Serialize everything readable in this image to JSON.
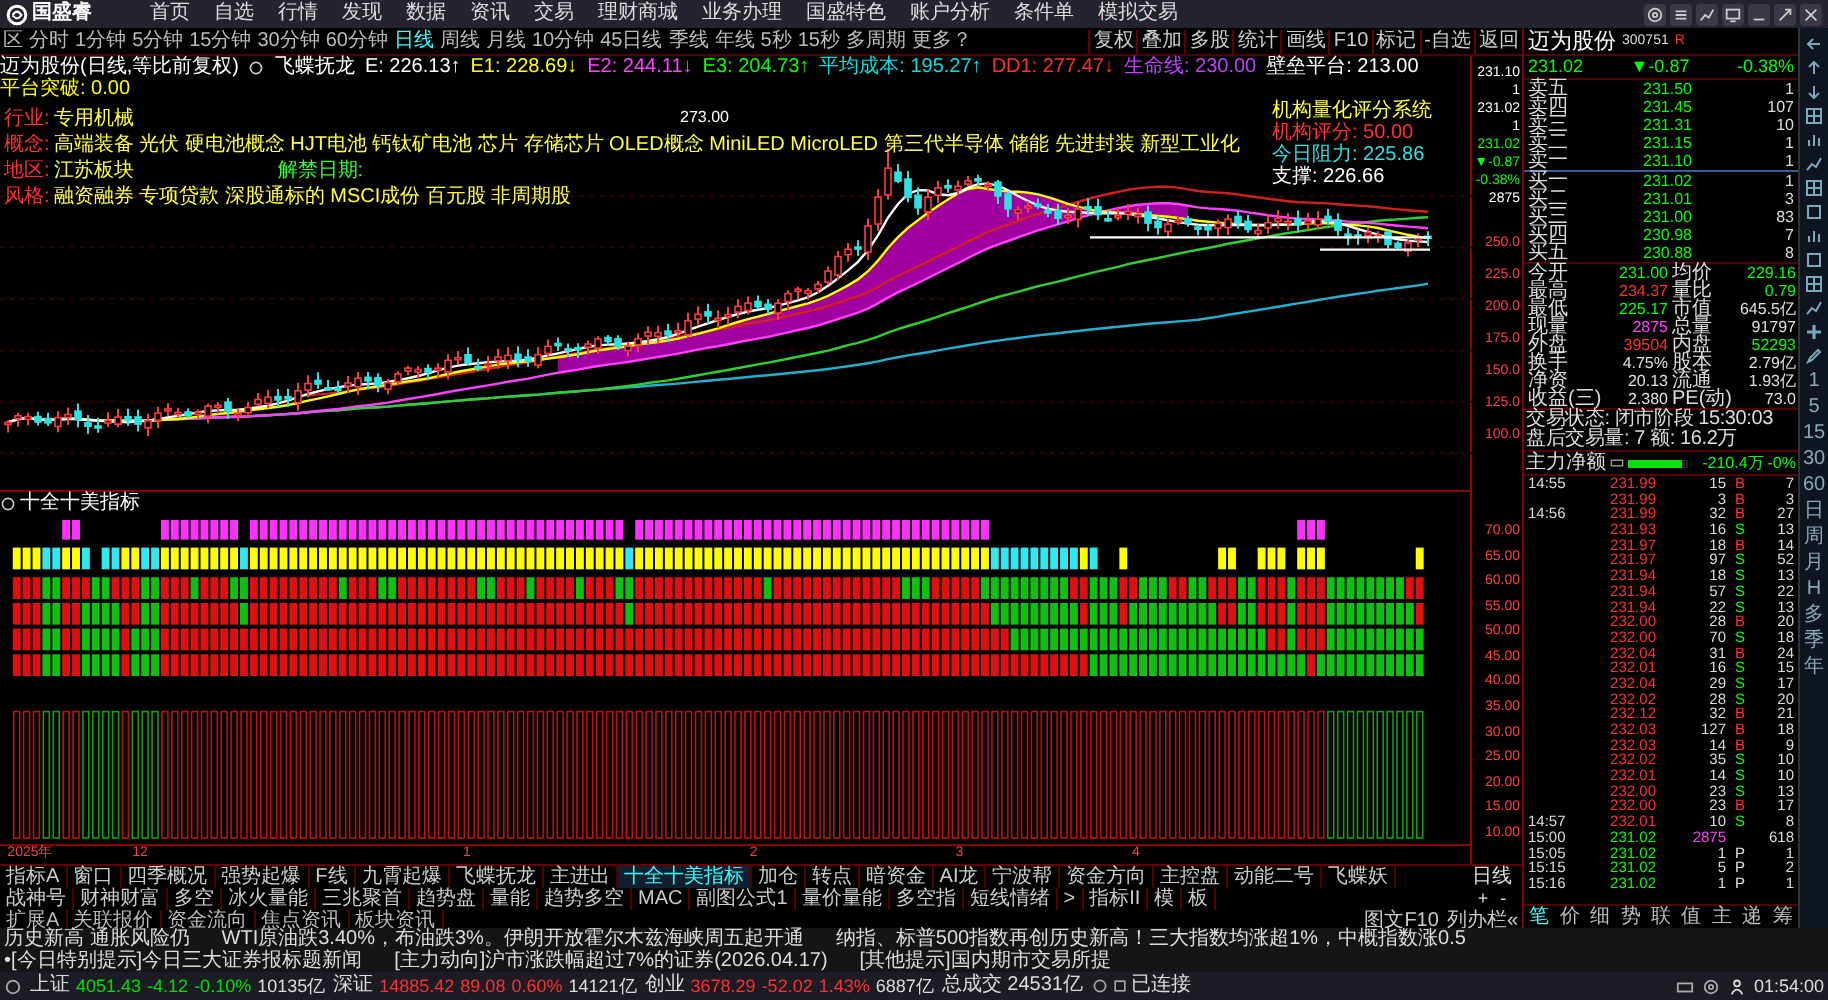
{
  "menu_bar": {
    "logo": "国盛睿",
    "items": [
      "首页",
      "自选",
      "行情",
      "发现",
      "数据",
      "资讯",
      "交易",
      "理财商城",
      "业务办理",
      "国盛特色",
      "账户分析",
      "条件单",
      "模拟交易"
    ]
  },
  "period_bar": {
    "items": [
      {
        "label": "区",
        "selected": false
      },
      {
        "label": "分时",
        "selected": false
      },
      {
        "label": "1分钟",
        "selected": false
      },
      {
        "label": "5分钟",
        "selected": false
      },
      {
        "label": "15分钟",
        "selected": false
      },
      {
        "label": "30分钟",
        "selected": false
      },
      {
        "label": "60分钟",
        "selected": false
      },
      {
        "label": "日线",
        "selected": true
      },
      {
        "label": "周线",
        "selected": false
      },
      {
        "label": "月线",
        "selected": false
      },
      {
        "label": "10分钟",
        "selected": false
      },
      {
        "label": "45日线",
        "selected": false
      },
      {
        "label": "季线",
        "selected": false
      },
      {
        "label": "年线",
        "selected": false
      },
      {
        "label": "5秒",
        "selected": false
      },
      {
        "label": "15秒",
        "selected": false
      },
      {
        "label": "多周期",
        "selected": false
      },
      {
        "label": "更多？",
        "selected": false
      }
    ],
    "tools": [
      "复权",
      "叠加",
      "多股",
      "统计",
      "画线",
      "F10",
      "标记",
      "-自选",
      "返回"
    ]
  },
  "indicator_line": {
    "title": "迈为股份(日线,等比前复权)",
    "name": "飞蝶抚龙",
    "values": [
      {
        "text": "E: 226.13↑",
        "color": "#ffffff"
      },
      {
        "text": "E1: 228.69↓",
        "color": "#ffff00"
      },
      {
        "text": "E2: 244.11↓",
        "color": "#ff40ff"
      },
      {
        "text": "E3: 204.73↑",
        "color": "#00ff00"
      },
      {
        "text": "平均成本: 195.27↑",
        "color": "#00e0e0"
      },
      {
        "text": "DD1: 277.47↓",
        "color": "#ff3030"
      },
      {
        "text": "生命线: 230.00",
        "color": "#c040ff"
      },
      {
        "text": "壁垒平台: 213.00",
        "color": "#ffffff"
      },
      {
        "text": "平台突破: 0.00",
        "color": "#ffff00"
      }
    ]
  },
  "stock_info": [
    {
      "label": "行业:",
      "value": "专用机械"
    },
    {
      "label": "概念:",
      "value": "高端装备 光伏 硬电池概念 HJT电池 钙钛矿电池 芯片 存储芯片 OLED概念 MiniLED MicroLED 第三代半导体 储能 先进封装 新型工业化"
    },
    {
      "label": "地区:",
      "value": "江苏板块",
      "note": "解禁日期:"
    },
    {
      "label": "风格:",
      "value": "融资融券 专项贷款 深股通标的 MSCI成份 百元股 非周期股"
    }
  ],
  "chart_annotations": {
    "peak": "273.00",
    "panel_title": "机构量化评分系统",
    "score": "机构评分: 50.00",
    "resistance": "今日阻力: 225.86",
    "support": "支撑: 226.66"
  },
  "price_axis": {
    "quote": [
      {
        "text": "231.10",
        "color": "#ffffff"
      },
      {
        "text": "1",
        "color": "#ffffff"
      },
      {
        "text": "231.02",
        "color": "#ffffff"
      },
      {
        "text": "1",
        "color": "#ffffff"
      },
      {
        "text": "231.02",
        "color": "#00ff00"
      },
      {
        "text": "▼-0.87",
        "color": "#00ff00"
      },
      {
        "text": "-0.38%",
        "color": "#00ff00"
      },
      {
        "text": "2875",
        "color": "#ffffff"
      }
    ],
    "ticks": [
      "250.0",
      "225.0",
      "200.0",
      "175.0",
      "150.0",
      "125.0",
      "100.0"
    ]
  },
  "sub_chart": {
    "title": "十全十美指标",
    "axis": [
      "70.00",
      "65.00",
      "60.00",
      "55.00",
      "50.00",
      "45.00",
      "40.00",
      "35.00",
      "30.00",
      "25.00",
      "20.00",
      "15.00",
      "10.00"
    ]
  },
  "date_axis": [
    "2025年",
    "12",
    "1",
    "2",
    "3",
    "4"
  ],
  "indicator_tabs": [
    {
      "label": "指标A",
      "selected": false
    },
    {
      "label": "窗口",
      "selected": false
    },
    {
      "label": "四季概况",
      "selected": false
    },
    {
      "label": "强势起爆",
      "selected": false
    },
    {
      "label": "F线",
      "selected": false
    },
    {
      "label": "九霄起爆",
      "selected": false
    },
    {
      "label": "飞蝶抚龙",
      "selected": false
    },
    {
      "label": "主进出",
      "selected": false
    },
    {
      "label": "十全十美指标",
      "selected": true
    },
    {
      "label": "加仓",
      "selected": false
    },
    {
      "label": "转点",
      "selected": false
    },
    {
      "label": "暗资金",
      "selected": false
    },
    {
      "label": "AI龙",
      "selected": false
    },
    {
      "label": "宁波帮",
      "selected": false
    },
    {
      "label": "资金方向",
      "selected": false
    },
    {
      "label": "主控盘",
      "selected": false
    },
    {
      "label": "动能二号",
      "selected": false
    },
    {
      "label": "飞蝶妖",
      "selected": false
    },
    {
      "label": "战神号",
      "selected": false
    },
    {
      "label": "财神财富",
      "selected": false
    },
    {
      "label": "多空",
      "selected": false
    },
    {
      "label": "冰火量能",
      "selected": false
    },
    {
      "label": "三兆聚首",
      "selected": false
    },
    {
      "label": "趋势盘",
      "selected": false
    },
    {
      "label": "量能",
      "selected": false
    },
    {
      "label": "趋势多空",
      "selected": false
    },
    {
      "label": "MAC",
      "selected": false
    },
    {
      "label": "副图公式1",
      "selected": false
    },
    {
      "label": "量价量能",
      "selected": false
    },
    {
      "label": "多空指",
      "selected": false
    },
    {
      "label": "短线情绪",
      "selected": false
    },
    {
      "label": ">",
      "selected": false
    },
    {
      "label": "指标II",
      "selected": false
    },
    {
      "label": "模",
      "selected": false
    },
    {
      "label": "板",
      "selected": false
    }
  ],
  "period_switch": {
    "label": "日线",
    "plus": "+",
    "minus": "-"
  },
  "extension_tabs": [
    "扩展A",
    "关联报价",
    "资金流向",
    "焦点资讯",
    "板块资讯"
  ],
  "panel_links": [
    "图文F10",
    "列办栏«"
  ],
  "quote": {
    "name": "迈为股份",
    "code": "300751",
    "badge": "R",
    "price": "231.02",
    "change": "▼-0.87",
    "percent": "-0.38%",
    "falling": true,
    "asks": [
      {
        "label": "卖五",
        "price": "231.50",
        "volume": "1"
      },
      {
        "label": "卖四",
        "price": "231.45",
        "volume": "107"
      },
      {
        "label": "卖三",
        "price": "231.31",
        "volume": "10"
      },
      {
        "label": "卖二",
        "price": "231.15",
        "volume": "1"
      },
      {
        "label": "卖一",
        "price": "231.10",
        "volume": "1"
      }
    ],
    "bids": [
      {
        "label": "买一",
        "price": "231.02",
        "volume": "1"
      },
      {
        "label": "买二",
        "price": "231.01",
        "volume": "3"
      },
      {
        "label": "买三",
        "price": "231.00",
        "volume": "83"
      },
      {
        "label": "买四",
        "price": "230.98",
        "volume": "7"
      },
      {
        "label": "买五",
        "price": "230.88",
        "volume": "8"
      }
    ],
    "stats": [
      {
        "label": "今开",
        "value": "231.00",
        "color": "#00ff00"
      },
      {
        "label": "均价",
        "value": "229.16",
        "color": "#00ff00"
      },
      {
        "label": "最高",
        "value": "234.37",
        "color": "#ff3030"
      },
      {
        "label": "量比",
        "value": "0.79",
        "color": "#00ff00"
      },
      {
        "label": "最低",
        "value": "225.17",
        "color": "#00ff00"
      },
      {
        "label": "市值",
        "value": "645.5亿",
        "color": "#e0e0e0"
      },
      {
        "label": "现量",
        "value": "2875",
        "color": "#ff40ff"
      },
      {
        "label": "总量",
        "value": "91797",
        "color": "#e0e0e0"
      },
      {
        "label": "外盘",
        "value": "39504",
        "color": "#ff3030"
      },
      {
        "label": "内盘",
        "value": "52293",
        "color": "#00ff00"
      },
      {
        "label": "换手",
        "value": "4.75%",
        "color": "#e0e0e0"
      },
      {
        "label": "股本",
        "value": "2.79亿",
        "color": "#e0e0e0"
      },
      {
        "label": "净资",
        "value": "20.13",
        "color": "#e0e0e0"
      },
      {
        "label": "流通",
        "value": "1.93亿",
        "color": "#e0e0e0"
      },
      {
        "label": "收益(三)",
        "value": "2.380",
        "color": "#e0e0e0"
      },
      {
        "label": "PE(动)",
        "value": "73.0",
        "color": "#e0e0e0"
      }
    ],
    "trade_status": [
      "交易状态: 闭市阶段 15:30:03",
      "盘后交易量: 7 额: 16.2万"
    ],
    "main_flow": {
      "label": "主力净额",
      "level": 0.9,
      "value": "-210.4万",
      "percent": "-0%"
    }
  },
  "ticks": [
    {
      "kind": "trade",
      "time": "14:55",
      "price": "231.99",
      "color": "#ff3030",
      "volume": "15",
      "side": "B",
      "count": "7"
    },
    {
      "kind": "trade",
      "price": "231.99",
      "color": "#ff3030",
      "volume": "3",
      "side": "B",
      "count": "3"
    },
    {
      "kind": "trade",
      "time": "14:56",
      "price": "231.99",
      "color": "#ff3030",
      "volume": "32",
      "side": "B",
      "count": "27"
    },
    {
      "kind": "trade",
      "price": "231.93",
      "color": "#ff3030",
      "volume": "16",
      "side": "S",
      "count": "13"
    },
    {
      "kind": "trade",
      "price": "231.97",
      "color": "#ff3030",
      "volume": "18",
      "side": "B",
      "count": "14"
    },
    {
      "kind": "trade",
      "price": "231.97",
      "color": "#ff3030",
      "volume": "97",
      "side": "S",
      "count": "52"
    },
    {
      "kind": "trade",
      "price": "231.94",
      "color": "#ff3030",
      "volume": "18",
      "side": "S",
      "count": "13"
    },
    {
      "kind": "trade",
      "price": "231.94",
      "color": "#ff3030",
      "volume": "57",
      "side": "S",
      "count": "22"
    },
    {
      "kind": "trade",
      "price": "231.94",
      "color": "#ff3030",
      "volume": "22",
      "side": "S",
      "count": "13"
    },
    {
      "kind": "trade",
      "price": "232.00",
      "color": "#ff3030",
      "volume": "28",
      "side": "B",
      "count": "20"
    },
    {
      "kind": "trade",
      "price": "232.00",
      "color": "#ff3030",
      "volume": "70",
      "side": "S",
      "count": "18"
    },
    {
      "kind": "trade",
      "price": "232.04",
      "color": "#ff3030",
      "volume": "31",
      "side": "B",
      "count": "24"
    },
    {
      "kind": "trade",
      "price": "232.01",
      "color": "#ff3030",
      "volume": "16",
      "side": "S",
      "count": "15"
    },
    {
      "kind": "trade",
      "price": "232.04",
      "color": "#ff3030",
      "volume": "29",
      "side": "S",
      "count": "17"
    },
    {
      "kind": "trade",
      "price": "232.02",
      "color": "#ff3030",
      "volume": "28",
      "side": "S",
      "count": "20"
    },
    {
      "kind": "trade",
      "price": "232.12",
      "color": "#ff3030",
      "volume": "32",
      "side": "B",
      "count": "21"
    },
    {
      "kind": "trade",
      "price": "232.03",
      "color": "#ff3030",
      "volume": "127",
      "side": "B",
      "count": "18"
    },
    {
      "kind": "trade",
      "price": "232.03",
      "color": "#ff3030",
      "volume": "14",
      "side": "B",
      "count": "9"
    },
    {
      "kind": "trade",
      "price": "232.02",
      "color": "#ff3030",
      "volume": "35",
      "side": "S",
      "count": "10"
    },
    {
      "kind": "trade",
      "price": "232.01",
      "color": "#ff3030",
      "volume": "14",
      "side": "S",
      "count": "10"
    },
    {
      "kind": "trade",
      "price": "232.00",
      "color": "#ff3030",
      "volume": "23",
      "side": "S",
      "count": "13"
    },
    {
      "kind": "trade",
      "price": "232.00",
      "color": "#ff3030",
      "volume": "23",
      "side": "B",
      "count": "17"
    },
    {
      "kind": "trade",
      "time": "14:57",
      "price": "232.01",
      "color": "#ff3030",
      "volume": "10",
      "side": "S",
      "count": "8"
    },
    {
      "kind": "close",
      "time": "15:00",
      "price": "231.02",
      "color": "#00ff00",
      "volume": "2875",
      "count": "618"
    },
    {
      "kind": "trade",
      "time": "15:05",
      "price": "231.02",
      "color": "#00ff00",
      "volume": "1",
      "side": "P",
      "count": "1"
    },
    {
      "kind": "trade",
      "time": "15:15",
      "price": "231.02",
      "color": "#00ff00",
      "volume": "5",
      "side": "P",
      "count": "2"
    },
    {
      "kind": "trade",
      "time": "15:16",
      "price": "231.02",
      "color": "#00ff00",
      "volume": "1",
      "side": "P",
      "count": "1"
    }
  ],
  "panel_tabs": [
    {
      "label": "笔",
      "selected": true
    },
    {
      "label": "价",
      "selected": false
    },
    {
      "label": "细",
      "selected": false
    },
    {
      "label": "势",
      "selected": false
    },
    {
      "label": "联",
      "selected": false
    },
    {
      "label": "值",
      "selected": false
    },
    {
      "label": "主",
      "selected": false
    },
    {
      "label": "递",
      "selected": false
    },
    {
      "label": "筹",
      "selected": false
    }
  ],
  "strip_periods": [
    "1",
    "5",
    "15",
    "30",
    "60",
    "日",
    "周",
    "月",
    "H",
    "多",
    "季",
    "年"
  ],
  "news_ticker": [
    "历史新高 通胀风险仍",
    "WTI原油跌3.40%，布油跌3%。伊朗开放霍尔木兹海峡周五起开通",
    "纳指、标普500指数再创历史新高！三大指数均涨超1%，中概指数涨0.5",
    "•[今日特别提示]今日三大证券报标题新闻",
    "[主力动向]沪市涨跌幅超过7%的证券(2026.04.17)",
    "[其他提示]国内期市交易所提"
  ],
  "status_bar": {
    "indices": [
      {
        "name": "上证",
        "value": "4051.43",
        "change": "-4.12",
        "percent": "-0.10%",
        "amount": "10135亿",
        "falling": true
      },
      {
        "name": "深证",
        "value": "14885.42",
        "change": "89.08",
        "percent": "0.60%",
        "amount": "14121亿",
        "falling": false
      },
      {
        "name": "创业",
        "value": "3678.29",
        "change": "-52.02",
        "percent": "1.43%",
        "amount": "6887亿",
        "falling": false
      }
    ],
    "total": "总成交 24531亿",
    "connection": "已连接",
    "time": "01:54:00"
  }
}
